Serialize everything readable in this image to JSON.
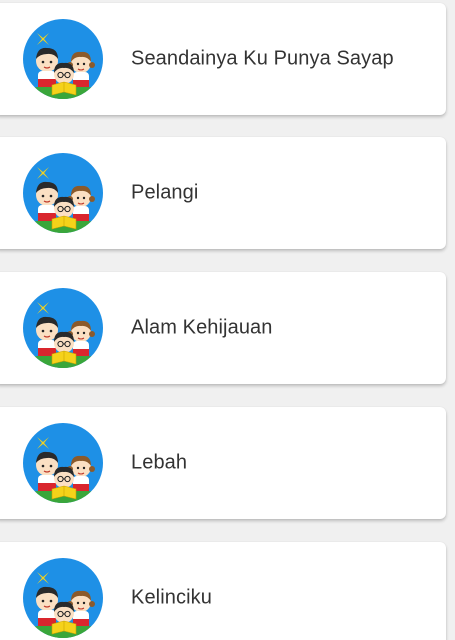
{
  "colors": {
    "background": "#f0f0f0",
    "card": "#ffffff",
    "text": "#333333",
    "avatar_bg": "#1e90e6"
  },
  "song_list": {
    "items": [
      {
        "title": "Seandainya Ku Punya Sayap",
        "icon": "kids-reading-icon"
      },
      {
        "title": "Pelangi",
        "icon": "kids-reading-icon"
      },
      {
        "title": "Alam Kehijauan",
        "icon": "kids-reading-icon"
      },
      {
        "title": "Lebah",
        "icon": "kids-reading-icon"
      },
      {
        "title": "Kelinciku",
        "icon": "kids-reading-icon"
      }
    ]
  }
}
